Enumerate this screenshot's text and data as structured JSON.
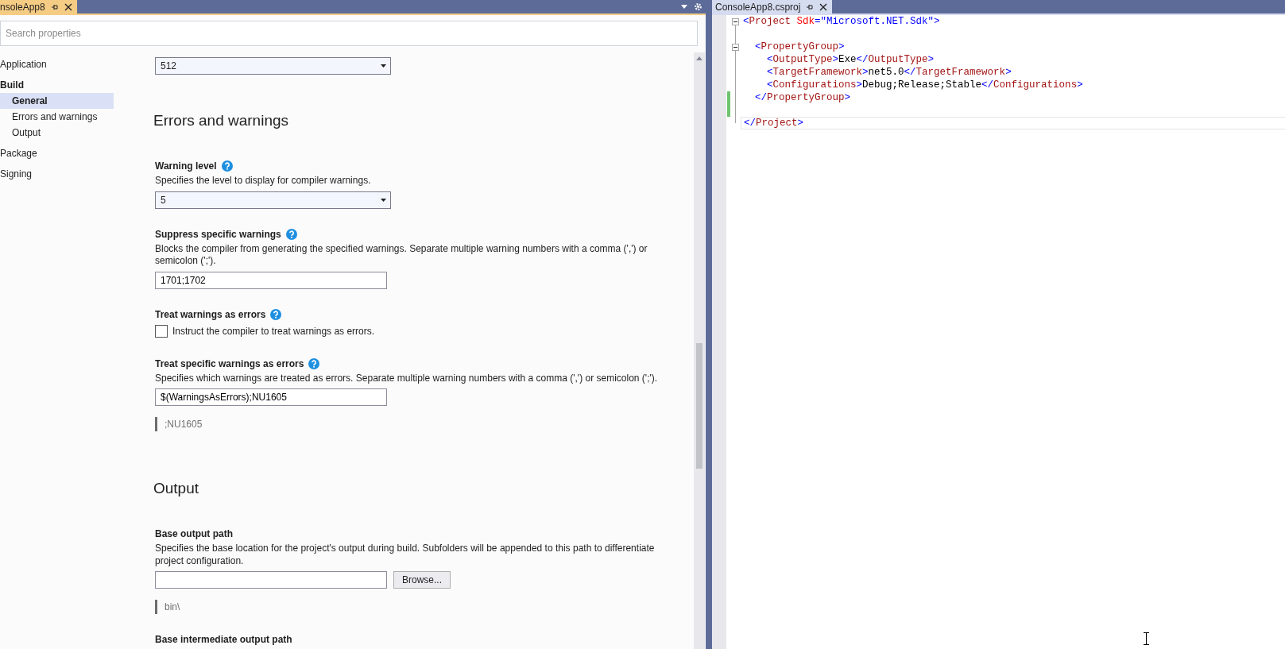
{
  "left_tab": {
    "title": "nsoleApp8",
    "selected": true
  },
  "search": {
    "placeholder": "Search properties"
  },
  "sidebar": {
    "items": [
      {
        "label": "Application",
        "selected": false
      },
      {
        "label": "Build",
        "selected": false,
        "children": [
          {
            "label": "General",
            "selected": true
          },
          {
            "label": "Errors and warnings",
            "selected": false
          },
          {
            "label": "Output",
            "selected": false
          }
        ]
      },
      {
        "label": "Package",
        "selected": false
      },
      {
        "label": "Signing",
        "selected": false
      }
    ]
  },
  "sections": [
    {
      "settings": [
        {
          "kind": "dropdown",
          "value": "512"
        }
      ]
    },
    {
      "heading": "Errors and warnings",
      "settings": [
        {
          "kind": "dropdown",
          "label": "Warning level",
          "help": true,
          "description": "Specifies the level to display for compiler warnings.",
          "value": "5"
        },
        {
          "kind": "text",
          "label": "Suppress specific warnings",
          "help": true,
          "description": "Blocks the compiler from generating the specified warnings. Separate multiple warning numbers with a comma (',') or semicolon (';').",
          "value": "1701;1702"
        },
        {
          "kind": "checkbox",
          "label": "Treat warnings as errors",
          "help": true,
          "checked": false,
          "text": "Instruct the compiler to treat warnings as errors."
        },
        {
          "kind": "text",
          "label": "Treat specific warnings as errors",
          "help": true,
          "description": "Specifies which warnings are treated as errors. Separate multiple warning numbers with a comma (',') or semicolon (';').",
          "value": "$(WarningsAsErrors);NU1605",
          "hint": ";NU1605"
        }
      ]
    },
    {
      "heading": "Output",
      "settings": [
        {
          "kind": "path",
          "label": "Base output path",
          "help": false,
          "description": "Specifies the base location for the project's output during build. Subfolders will be appended to this path to differentiate project configuration.",
          "button": "Browse...",
          "hint": "bin\\"
        },
        {
          "kind": "label",
          "label": "Base intermediate output path",
          "help": false
        }
      ]
    }
  ],
  "right_tab": {
    "title": "ConsoleApp8.csproj",
    "selected": false
  },
  "code": [
    {
      "fold": true,
      "changed": false,
      "current": false,
      "tokens": [
        {
          "kind": "punct",
          "text": "<"
        },
        {
          "kind": "tag",
          "text": "Project"
        },
        {
          "kind": "attr",
          "text": " Sdk"
        },
        {
          "kind": "punct",
          "text": "=\"Microsoft.NET.Sdk\">"
        }
      ]
    },
    {
      "fold": false,
      "changed": false,
      "current": false
    },
    {
      "fold": true,
      "changed": false,
      "current": false,
      "tokens": [
        {
          "kind": "punct",
          "text": "  <"
        },
        {
          "kind": "tag",
          "text": "PropertyGroup"
        },
        {
          "kind": "punct",
          "text": ">"
        }
      ]
    },
    {
      "fold": false,
      "changed": false,
      "current": false,
      "tokens": [
        {
          "kind": "punct",
          "text": "    <"
        },
        {
          "kind": "tag",
          "text": "OutputType"
        },
        {
          "kind": "punct",
          "text": ">"
        },
        {
          "kind": "text",
          "text": "Exe"
        },
        {
          "kind": "punct",
          "text": "</"
        },
        {
          "kind": "tag",
          "text": "OutputType"
        },
        {
          "kind": "punct",
          "text": ">"
        }
      ]
    },
    {
      "fold": false,
      "changed": false,
      "current": false,
      "tokens": [
        {
          "kind": "punct",
          "text": "    <"
        },
        {
          "kind": "tag",
          "text": "TargetFramework"
        },
        {
          "kind": "punct",
          "text": ">"
        },
        {
          "kind": "text",
          "text": "net5.0"
        },
        {
          "kind": "punct",
          "text": "</"
        },
        {
          "kind": "tag",
          "text": "TargetFramework"
        },
        {
          "kind": "punct",
          "text": ">"
        }
      ]
    },
    {
      "fold": false,
      "changed": false,
      "current": false,
      "tokens": [
        {
          "kind": "punct",
          "text": "    <"
        },
        {
          "kind": "tag",
          "text": "Configurations"
        },
        {
          "kind": "punct",
          "text": ">"
        },
        {
          "kind": "text",
          "text": "Debug;Release;Stable"
        },
        {
          "kind": "punct",
          "text": "</"
        },
        {
          "kind": "tag",
          "text": "Configurations"
        },
        {
          "kind": "punct",
          "text": ">"
        }
      ]
    },
    {
      "fold": false,
      "changed": true,
      "current": false,
      "tokens": [
        {
          "kind": "punct",
          "text": "  </"
        },
        {
          "kind": "tag",
          "text": "PropertyGroup"
        },
        {
          "kind": "punct",
          "text": ">"
        }
      ]
    },
    {
      "fold": false,
      "changed": true,
      "current": false
    },
    {
      "fold": false,
      "changed": false,
      "current": true,
      "tokens": [
        {
          "kind": "punct",
          "text": "</"
        },
        {
          "kind": "tag",
          "text": "Project"
        },
        {
          "kind": "punct",
          "text": ">"
        }
      ]
    }
  ]
}
